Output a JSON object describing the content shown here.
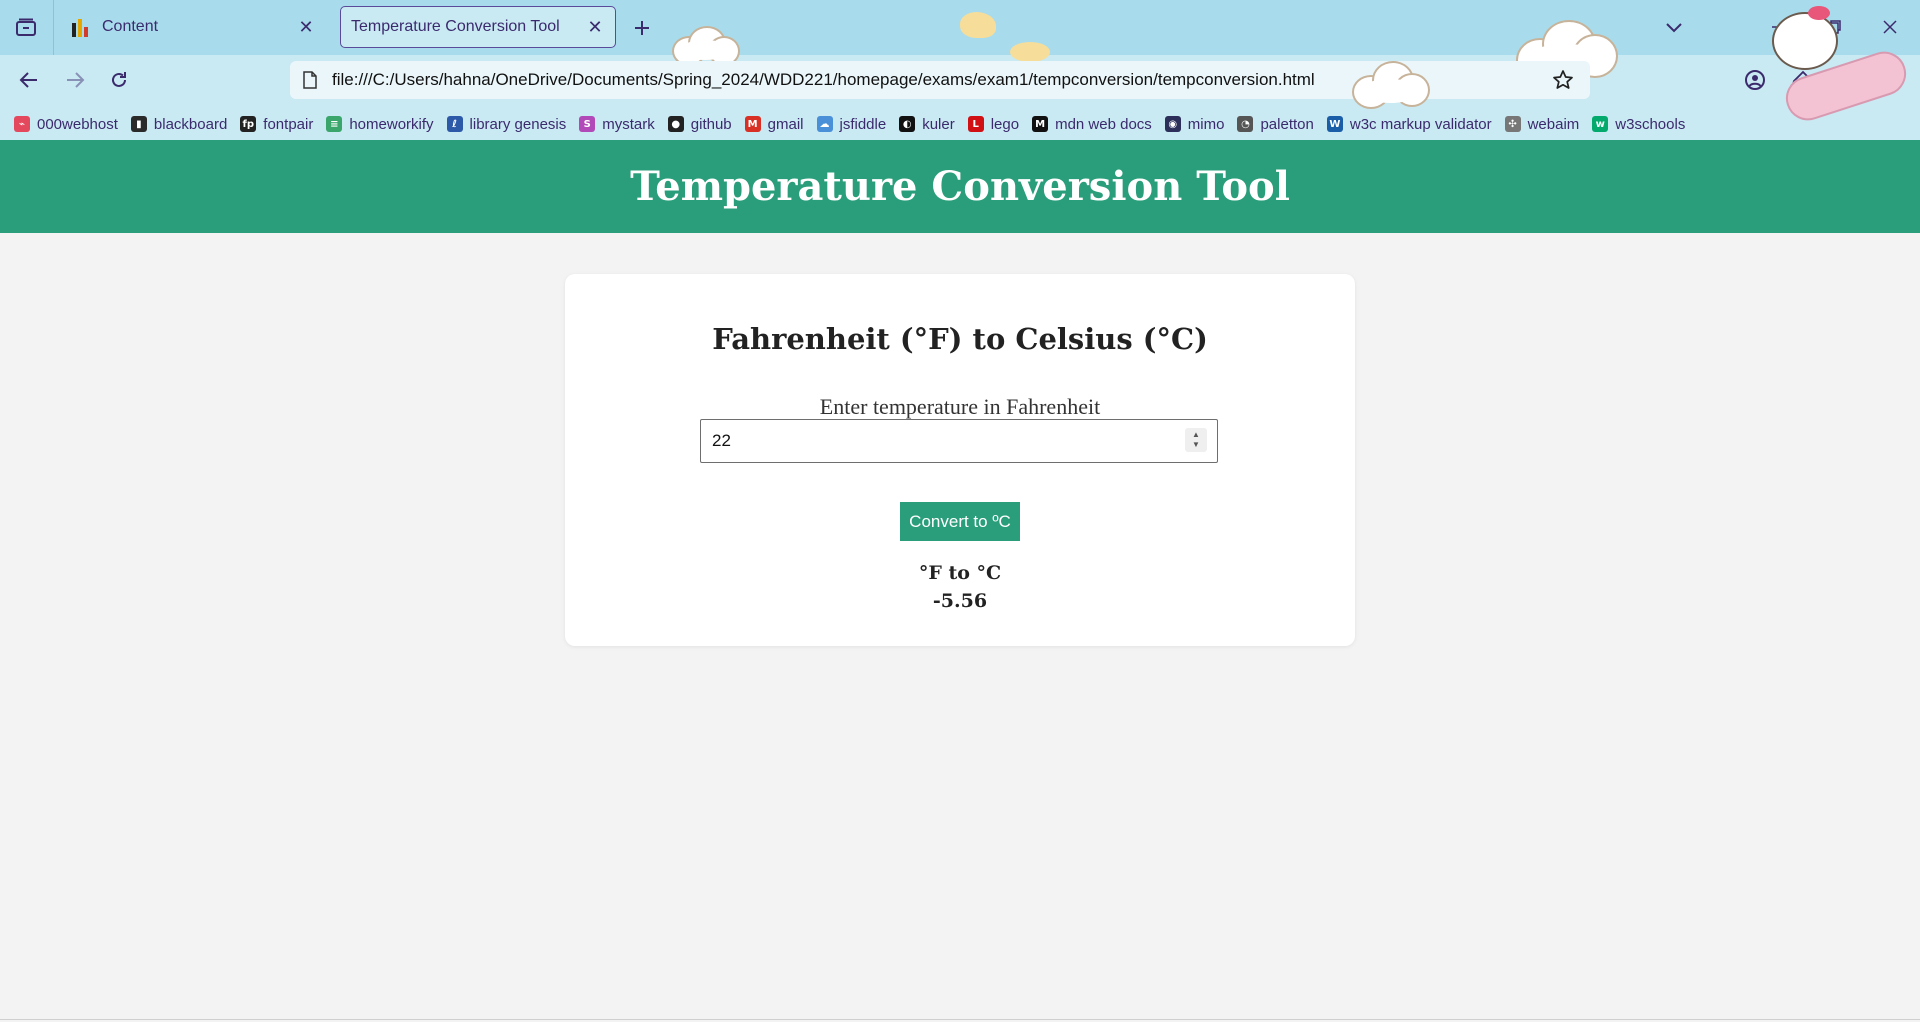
{
  "browser": {
    "tabs": [
      {
        "title": "Content",
        "active": false,
        "favicon": "bar-chart-favicon"
      },
      {
        "title": "Temperature Conversion Tool",
        "active": true
      }
    ],
    "url": "file:///C:/Users/hahna/OneDrive/Documents/Spring_2024/WDD221/homepage/exams/exam1/tempconversion/tempconversion.html",
    "bookmarks": [
      {
        "label": "000webhost",
        "icon": "webhost-icon",
        "color": "#e4485d"
      },
      {
        "label": "blackboard",
        "icon": "bar-chart-icon",
        "color": "#2a2a2a"
      },
      {
        "label": "fontpair",
        "icon": "fontpair-icon",
        "color": "#222222"
      },
      {
        "label": "homeworkify",
        "icon": "books-icon",
        "color": "#3aa66b"
      },
      {
        "label": "library genesis",
        "icon": "library-icon",
        "color": "#2d5aa8"
      },
      {
        "label": "mystark",
        "icon": "mystark-icon",
        "color": "#b14ab8"
      },
      {
        "label": "github",
        "icon": "github-icon",
        "color": "#222222"
      },
      {
        "label": "gmail",
        "icon": "gmail-icon",
        "color": "#d93025"
      },
      {
        "label": "jsfiddle",
        "icon": "cloud-icon",
        "color": "#4a90d9"
      },
      {
        "label": "kuler",
        "icon": "kuler-icon",
        "color": "#111111"
      },
      {
        "label": "lego",
        "icon": "lego-icon",
        "color": "#d01012"
      },
      {
        "label": "mdn web docs",
        "icon": "mdn-icon",
        "color": "#111111"
      },
      {
        "label": "mimo",
        "icon": "mimo-icon",
        "color": "#2b2f5a"
      },
      {
        "label": "paletton",
        "icon": "paletton-icon",
        "color": "#555555"
      },
      {
        "label": "w3c markup validator",
        "icon": "w3c-icon",
        "color": "#1a5ea8"
      },
      {
        "label": "webaim",
        "icon": "webaim-icon",
        "color": "#777777"
      },
      {
        "label": "w3schools",
        "icon": "w3schools-icon",
        "color": "#04aa6d"
      }
    ]
  },
  "page": {
    "header_title": "Temperature Conversion Tool",
    "card": {
      "heading": "Fahrenheit (°F) to Celsius (°C)",
      "input_label": "Enter temperature in Fahrenheit",
      "input_value": "22",
      "button_label": "Convert to ºC",
      "result_label": "°F to °C",
      "result_value": "-5.56"
    }
  },
  "colors": {
    "accent": "#2a9e7a",
    "tabbar": "#a8dcec",
    "toolbar": "#c9e9f3",
    "page_bg": "#f3f3f3",
    "chrome_text": "#3b2b6d"
  }
}
